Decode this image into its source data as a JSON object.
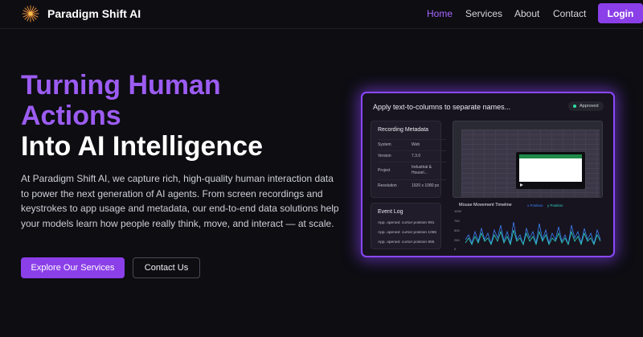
{
  "nav": {
    "brand": "Paradigm Shift AI",
    "links": [
      "Home",
      "Services",
      "About",
      "Contact"
    ],
    "login": "Login"
  },
  "hero": {
    "title_line1": "Turning Human",
    "title_line2": "Actions",
    "title_line3": "Into AI Intelligence",
    "description": "At Paradigm Shift AI, we capture rich, high-quality human interaction data to power the next generation of AI agents. From screen recordings and keystrokes to app usage and metadata, our end-to-end data solutions help your models learn how people really think, move, and interact — at scale.",
    "primary_cta": "Explore Our Services",
    "secondary_cta": "Contact Us"
  },
  "dashboard": {
    "task_title": "Apply text-to-columns to separate names...",
    "status": "Approved",
    "metadata": {
      "title": "Recording Metadata",
      "rows": [
        {
          "key": "System",
          "value": "Web"
        },
        {
          "key": "Version",
          "value": "7.3.0"
        },
        {
          "key": "Project",
          "value": "Industrial & Housel..."
        },
        {
          "key": "Resolution",
          "value": "1920 x 1080 px"
        }
      ]
    },
    "event_log": {
      "title": "Event Log",
      "rows": [
        "App. opened: cursor position 991",
        "App. opened: cursor position 1065",
        "App. opened: cursor position 855"
      ]
    },
    "timeline": {
      "title": "Mouse Movement Timeline",
      "legend_x": "x Position",
      "legend_y": "y Position",
      "y_ticks": [
        "1000",
        "750",
        "500",
        "250",
        "0"
      ]
    }
  },
  "colors": {
    "accent": "#8b3fe8",
    "title_purple": "#9c5cf2",
    "background": "#0d0d12",
    "x_series": "#3b82f6",
    "y_series": "#2dd4bf"
  },
  "icons": {
    "brand": "starburst-logo-icon"
  }
}
